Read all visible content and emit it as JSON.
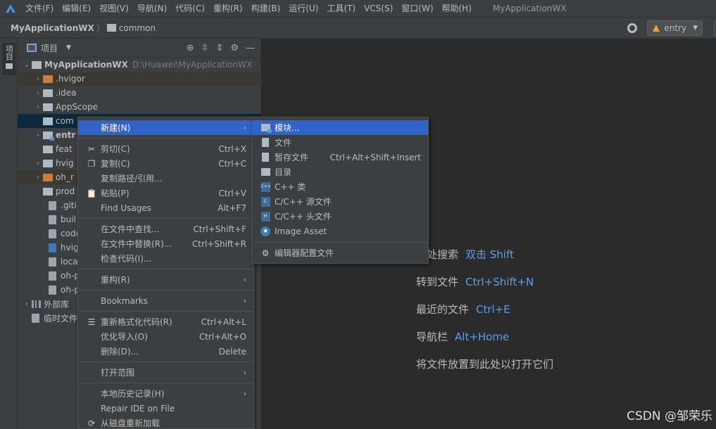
{
  "menubar": {
    "items": [
      "文件(F)",
      "编辑(E)",
      "视图(V)",
      "导航(N)",
      "代码(C)",
      "重构(R)",
      "构建(B)",
      "运行(U)",
      "工具(T)",
      "VCS(S)",
      "窗口(W)",
      "帮助(H)"
    ],
    "project_title": "MyApplicationWX"
  },
  "navbar": {
    "root": "MyApplicationWX",
    "folder": "common",
    "run_config": "entry"
  },
  "tool_stripe": {
    "project_tab": "项目"
  },
  "project_panel": {
    "view_label": "项目",
    "root": {
      "name": "MyApplicationWX",
      "path": "D:\\Huawei\\MyApplicationWX"
    },
    "rows": [
      ".hvigor",
      ".idea",
      "AppScope",
      "com",
      "entr",
      "feat",
      "hvig",
      "oh_r",
      "prod",
      ".giti",
      "buil",
      "code",
      "hvig",
      "loca",
      "oh-p",
      "oh-p"
    ],
    "external_libs": "外部库",
    "scratches": "临时文件"
  },
  "editor": {
    "hints": [
      {
        "label": "处处搜索",
        "key": "双击 Shift"
      },
      {
        "label": "转到文件",
        "key": "Ctrl+Shift+N"
      },
      {
        "label": "最近的文件",
        "key": "Ctrl+E"
      },
      {
        "label": "导航栏",
        "key": "Alt+Home"
      },
      {
        "label": "将文件放置到此处以打开它们",
        "key": ""
      }
    ],
    "watermark": "CSDN @邹荣乐"
  },
  "context_menu": {
    "items": [
      {
        "label": "新建(N)",
        "shortcut": "",
        "submenu": true
      },
      {
        "label": "剪切(C)",
        "shortcut": "Ctrl+X"
      },
      {
        "label": "复制(C)",
        "shortcut": "Ctrl+C"
      },
      {
        "label": "复制路径/引用...",
        "shortcut": ""
      },
      {
        "label": "粘贴(P)",
        "shortcut": "Ctrl+V"
      },
      {
        "label": "Find Usages",
        "shortcut": "Alt+F7"
      },
      {
        "label": "在文件中查找...",
        "shortcut": "Ctrl+Shift+F"
      },
      {
        "label": "在文件中替换(R)...",
        "shortcut": "Ctrl+Shift+R"
      },
      {
        "label": "检查代码(I)...",
        "shortcut": ""
      },
      {
        "label": "重构(R)",
        "shortcut": "",
        "submenu": true
      },
      {
        "label": "Bookmarks",
        "shortcut": "",
        "submenu": true
      },
      {
        "label": "重新格式化代码(R)",
        "shortcut": "Ctrl+Alt+L"
      },
      {
        "label": "优化导入(O)",
        "shortcut": "Ctrl+Alt+O"
      },
      {
        "label": "删除(D)...",
        "shortcut": "Delete"
      },
      {
        "label": "打开范围",
        "shortcut": "",
        "submenu": true
      },
      {
        "label": "本地历史记录(H)",
        "shortcut": "",
        "submenu": true
      },
      {
        "label": "Repair IDE on File",
        "shortcut": ""
      },
      {
        "label": "从磁盘重新加载",
        "shortcut": ""
      }
    ]
  },
  "submenu": {
    "items": [
      {
        "label": "模块...",
        "shortcut": ""
      },
      {
        "label": "文件",
        "shortcut": ""
      },
      {
        "label": "暂存文件",
        "shortcut": "Ctrl+Alt+Shift+Insert"
      },
      {
        "label": "目录",
        "shortcut": ""
      },
      {
        "label": "C++ 类",
        "shortcut": ""
      },
      {
        "label": "C/C++ 源文件",
        "shortcut": ""
      },
      {
        "label": "C/C++ 头文件",
        "shortcut": ""
      },
      {
        "label": "Image Asset",
        "shortcut": ""
      },
      {
        "label": "编辑器配置文件",
        "shortcut": ""
      }
    ]
  },
  "colors": {
    "accent": "#2f65ca",
    "link": "#5c9ee8",
    "background": "#2b2b2b",
    "panel": "#3c3f41"
  }
}
